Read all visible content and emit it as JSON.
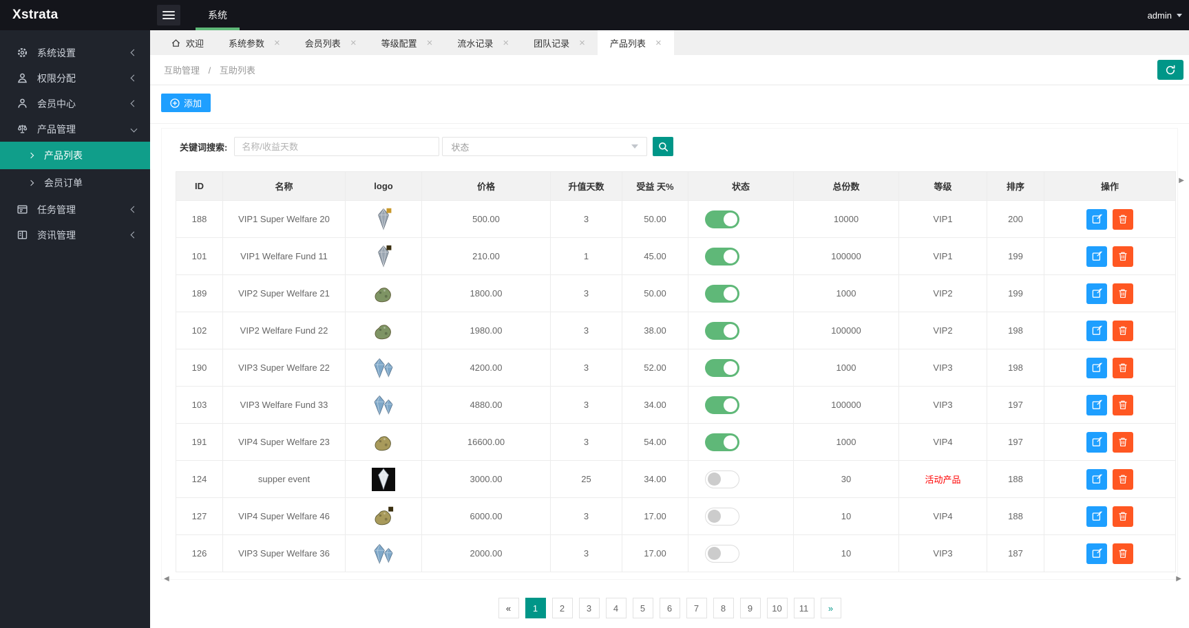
{
  "topbar": {
    "brand": "Xstrata",
    "menu_label": "系统",
    "user": "admin"
  },
  "sidebar": {
    "items": [
      {
        "label": "系统设置",
        "icon": "gear-icon",
        "expanded": false
      },
      {
        "label": "权限分配",
        "icon": "permission-icon",
        "expanded": false
      },
      {
        "label": "会员中心",
        "icon": "member-icon",
        "expanded": false
      },
      {
        "label": "产品管理",
        "icon": "product-icon",
        "expanded": true,
        "children": [
          {
            "label": "产品列表",
            "active": true
          },
          {
            "label": "会员订单",
            "active": false
          }
        ]
      },
      {
        "label": "任务管理",
        "icon": "task-icon",
        "expanded": false
      },
      {
        "label": "资讯管理",
        "icon": "news-icon",
        "expanded": false
      }
    ]
  },
  "tabs": [
    {
      "label": "欢迎",
      "icon": "home",
      "closable": false,
      "active": false
    },
    {
      "label": "系统参数",
      "closable": true,
      "active": false
    },
    {
      "label": "会员列表",
      "closable": true,
      "active": false
    },
    {
      "label": "等级配置",
      "closable": true,
      "active": false
    },
    {
      "label": "流水记录",
      "closable": true,
      "active": false
    },
    {
      "label": "团队记录",
      "closable": true,
      "active": false
    },
    {
      "label": "产品列表",
      "closable": true,
      "active": true
    }
  ],
  "breadcrumb": {
    "items": [
      "互助管理",
      "互助列表"
    ],
    "separator": "/"
  },
  "toolbar": {
    "add_label": "添加"
  },
  "search": {
    "label": "关键词搜索:",
    "keyword_placeholder": "名称/收益天数",
    "status_value": "状态"
  },
  "table": {
    "columns": [
      "ID",
      "名称",
      "logo",
      "价格",
      "升值天数",
      "受益 天%",
      "状态",
      "总份数",
      "等级",
      "排序",
      "操作"
    ],
    "rows": [
      {
        "id": "188",
        "name": "VIP1 Super Welfare 20",
        "logo": {
          "kind": "gem",
          "color": "#9aa5b1",
          "badge": "#c9992c",
          "dark": false
        },
        "price": "500.00",
        "rise_days": "3",
        "profit_day": "50.00",
        "status_on": true,
        "total": "10000",
        "level": "VIP1",
        "sort": "200"
      },
      {
        "id": "101",
        "name": "VIP1 Welfare Fund 11",
        "logo": {
          "kind": "gem",
          "color": "#9aa5b1",
          "badge": "#3a2f10",
          "dark": false
        },
        "price": "210.00",
        "rise_days": "1",
        "profit_day": "45.00",
        "status_on": true,
        "total": "100000",
        "level": "VIP1",
        "sort": "199"
      },
      {
        "id": "189",
        "name": "VIP2 Super Welfare 21",
        "logo": {
          "kind": "nugget",
          "color": "#7e9464",
          "badge": null,
          "dark": false
        },
        "price": "1800.00",
        "rise_days": "3",
        "profit_day": "50.00",
        "status_on": true,
        "total": "1000",
        "level": "VIP2",
        "sort": "199"
      },
      {
        "id": "102",
        "name": "VIP2 Welfare Fund 22",
        "logo": {
          "kind": "nugget",
          "color": "#7e9464",
          "badge": null,
          "dark": false
        },
        "price": "1980.00",
        "rise_days": "3",
        "profit_day": "38.00",
        "status_on": true,
        "total": "100000",
        "level": "VIP2",
        "sort": "198"
      },
      {
        "id": "190",
        "name": "VIP3 Super Welfare 22",
        "logo": {
          "kind": "gem-pair",
          "color": "#7fa8c9",
          "badge": null,
          "dark": false
        },
        "price": "4200.00",
        "rise_days": "3",
        "profit_day": "52.00",
        "status_on": true,
        "total": "1000",
        "level": "VIP3",
        "sort": "198"
      },
      {
        "id": "103",
        "name": "VIP3 Welfare Fund 33",
        "logo": {
          "kind": "gem-pair",
          "color": "#7fa8c9",
          "badge": null,
          "dark": false
        },
        "price": "4880.00",
        "rise_days": "3",
        "profit_day": "34.00",
        "status_on": true,
        "total": "100000",
        "level": "VIP3",
        "sort": "197"
      },
      {
        "id": "191",
        "name": "VIP4 Super Welfare 23",
        "logo": {
          "kind": "nugget",
          "color": "#a89a5b",
          "badge": null,
          "dark": false
        },
        "price": "16600.00",
        "rise_days": "3",
        "profit_day": "54.00",
        "status_on": true,
        "total": "1000",
        "level": "VIP4",
        "sort": "197"
      },
      {
        "id": "124",
        "name": "supper event",
        "logo": {
          "kind": "gem",
          "color": "#e2e7ec",
          "badge": null,
          "dark": true
        },
        "price": "3000.00",
        "rise_days": "25",
        "profit_day": "34.00",
        "status_on": false,
        "total": "30",
        "level": "活动产品",
        "level_color": "#ff0000",
        "sort": "188"
      },
      {
        "id": "127",
        "name": "VIP4 Super Welfare 46",
        "logo": {
          "kind": "nugget",
          "color": "#a89a5b",
          "badge": "#3a2f10",
          "dark": false
        },
        "price": "6000.00",
        "rise_days": "3",
        "profit_day": "17.00",
        "status_on": false,
        "total": "10",
        "level": "VIP4",
        "sort": "188"
      },
      {
        "id": "126",
        "name": "VIP3 Super Welfare 36",
        "logo": {
          "kind": "gem-pair",
          "color": "#7fa8c9",
          "badge": null,
          "dark": false
        },
        "price": "2000.00",
        "rise_days": "3",
        "profit_day": "17.00",
        "status_on": false,
        "total": "10",
        "level": "VIP3",
        "sort": "187"
      }
    ]
  },
  "pagination": {
    "pages": [
      "1",
      "2",
      "3",
      "4",
      "5",
      "6",
      "7",
      "8",
      "9",
      "10",
      "11"
    ],
    "active": "1"
  },
  "icons": {
    "close_glyph": "×",
    "prev_glyph": "«",
    "next_glyph": "»",
    "scroll_left_glyph": "◀",
    "scroll_right_glyph": "▶"
  },
  "colors": {
    "topbar_bg": "#14151b",
    "sidebar_bg": "#20242c",
    "sidebar_active": "#109e8a",
    "accent_green": "#5FB878",
    "accent_teal": "#009688",
    "accent_blue": "#1E9FFF",
    "accent_orange": "#FF5722",
    "level_alert": "#ff0000",
    "tabstrip_bg": "#f0f0f0",
    "table_header_bg": "#f2f2f2",
    "table_border": "#ececec"
  }
}
